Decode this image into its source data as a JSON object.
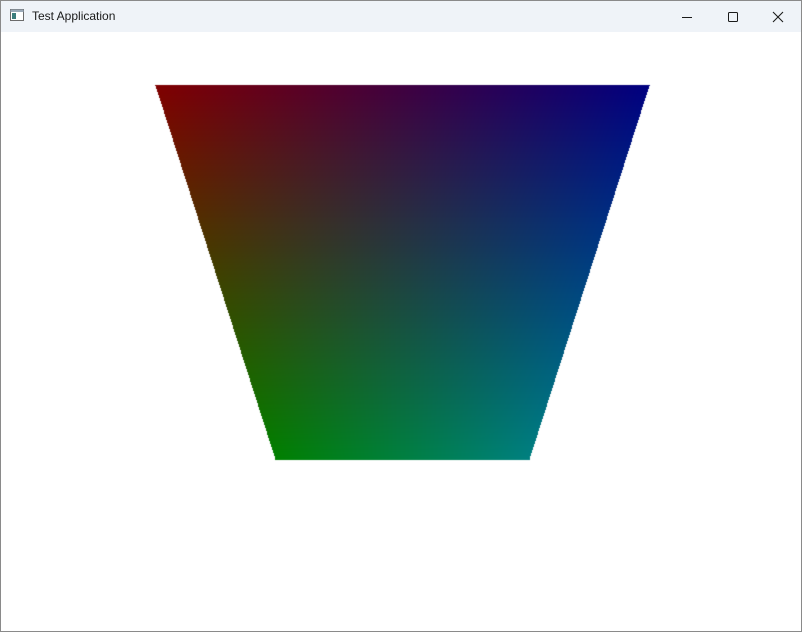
{
  "window": {
    "title": "Test Application",
    "controls": {
      "minimize": "minimize-icon",
      "maximize": "maximize-icon",
      "close": "close-icon"
    }
  },
  "scene": {
    "shape": "trapezoid",
    "vertex_colors": {
      "top_left": "#800000",
      "top_right": "#000080",
      "bottom_left": "#008000",
      "bottom_right": "#008080"
    },
    "background": "#ffffff"
  }
}
